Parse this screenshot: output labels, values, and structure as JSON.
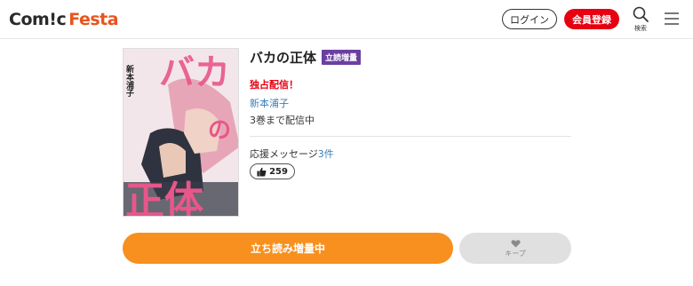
{
  "header": {
    "logo_prefix": "Com!c",
    "logo_suffix": "Festa",
    "login_label": "ログイン",
    "register_label": "会員登録",
    "search_label": "検索",
    "search_icon": "search-icon",
    "menu_icon": "hamburger-menu-icon"
  },
  "cover": {
    "title_text": "バカの正体",
    "author_text": "新本浦子"
  },
  "book": {
    "title": "バカの正体",
    "badge": "立読増量",
    "exclusive": "独占配信！",
    "author": "新本浦子",
    "volumes": "3巻まで配信中",
    "support_label": "応援メッセージ",
    "support_count": "3件",
    "like_count": "259"
  },
  "actions": {
    "read_label": "立ち読み増量中",
    "keep_label": "キープ"
  },
  "colors": {
    "brand_orange": "#f7901e",
    "register_red": "#e60012",
    "badge_purple": "#6b3fa0",
    "link_blue": "#3a7fb8"
  }
}
